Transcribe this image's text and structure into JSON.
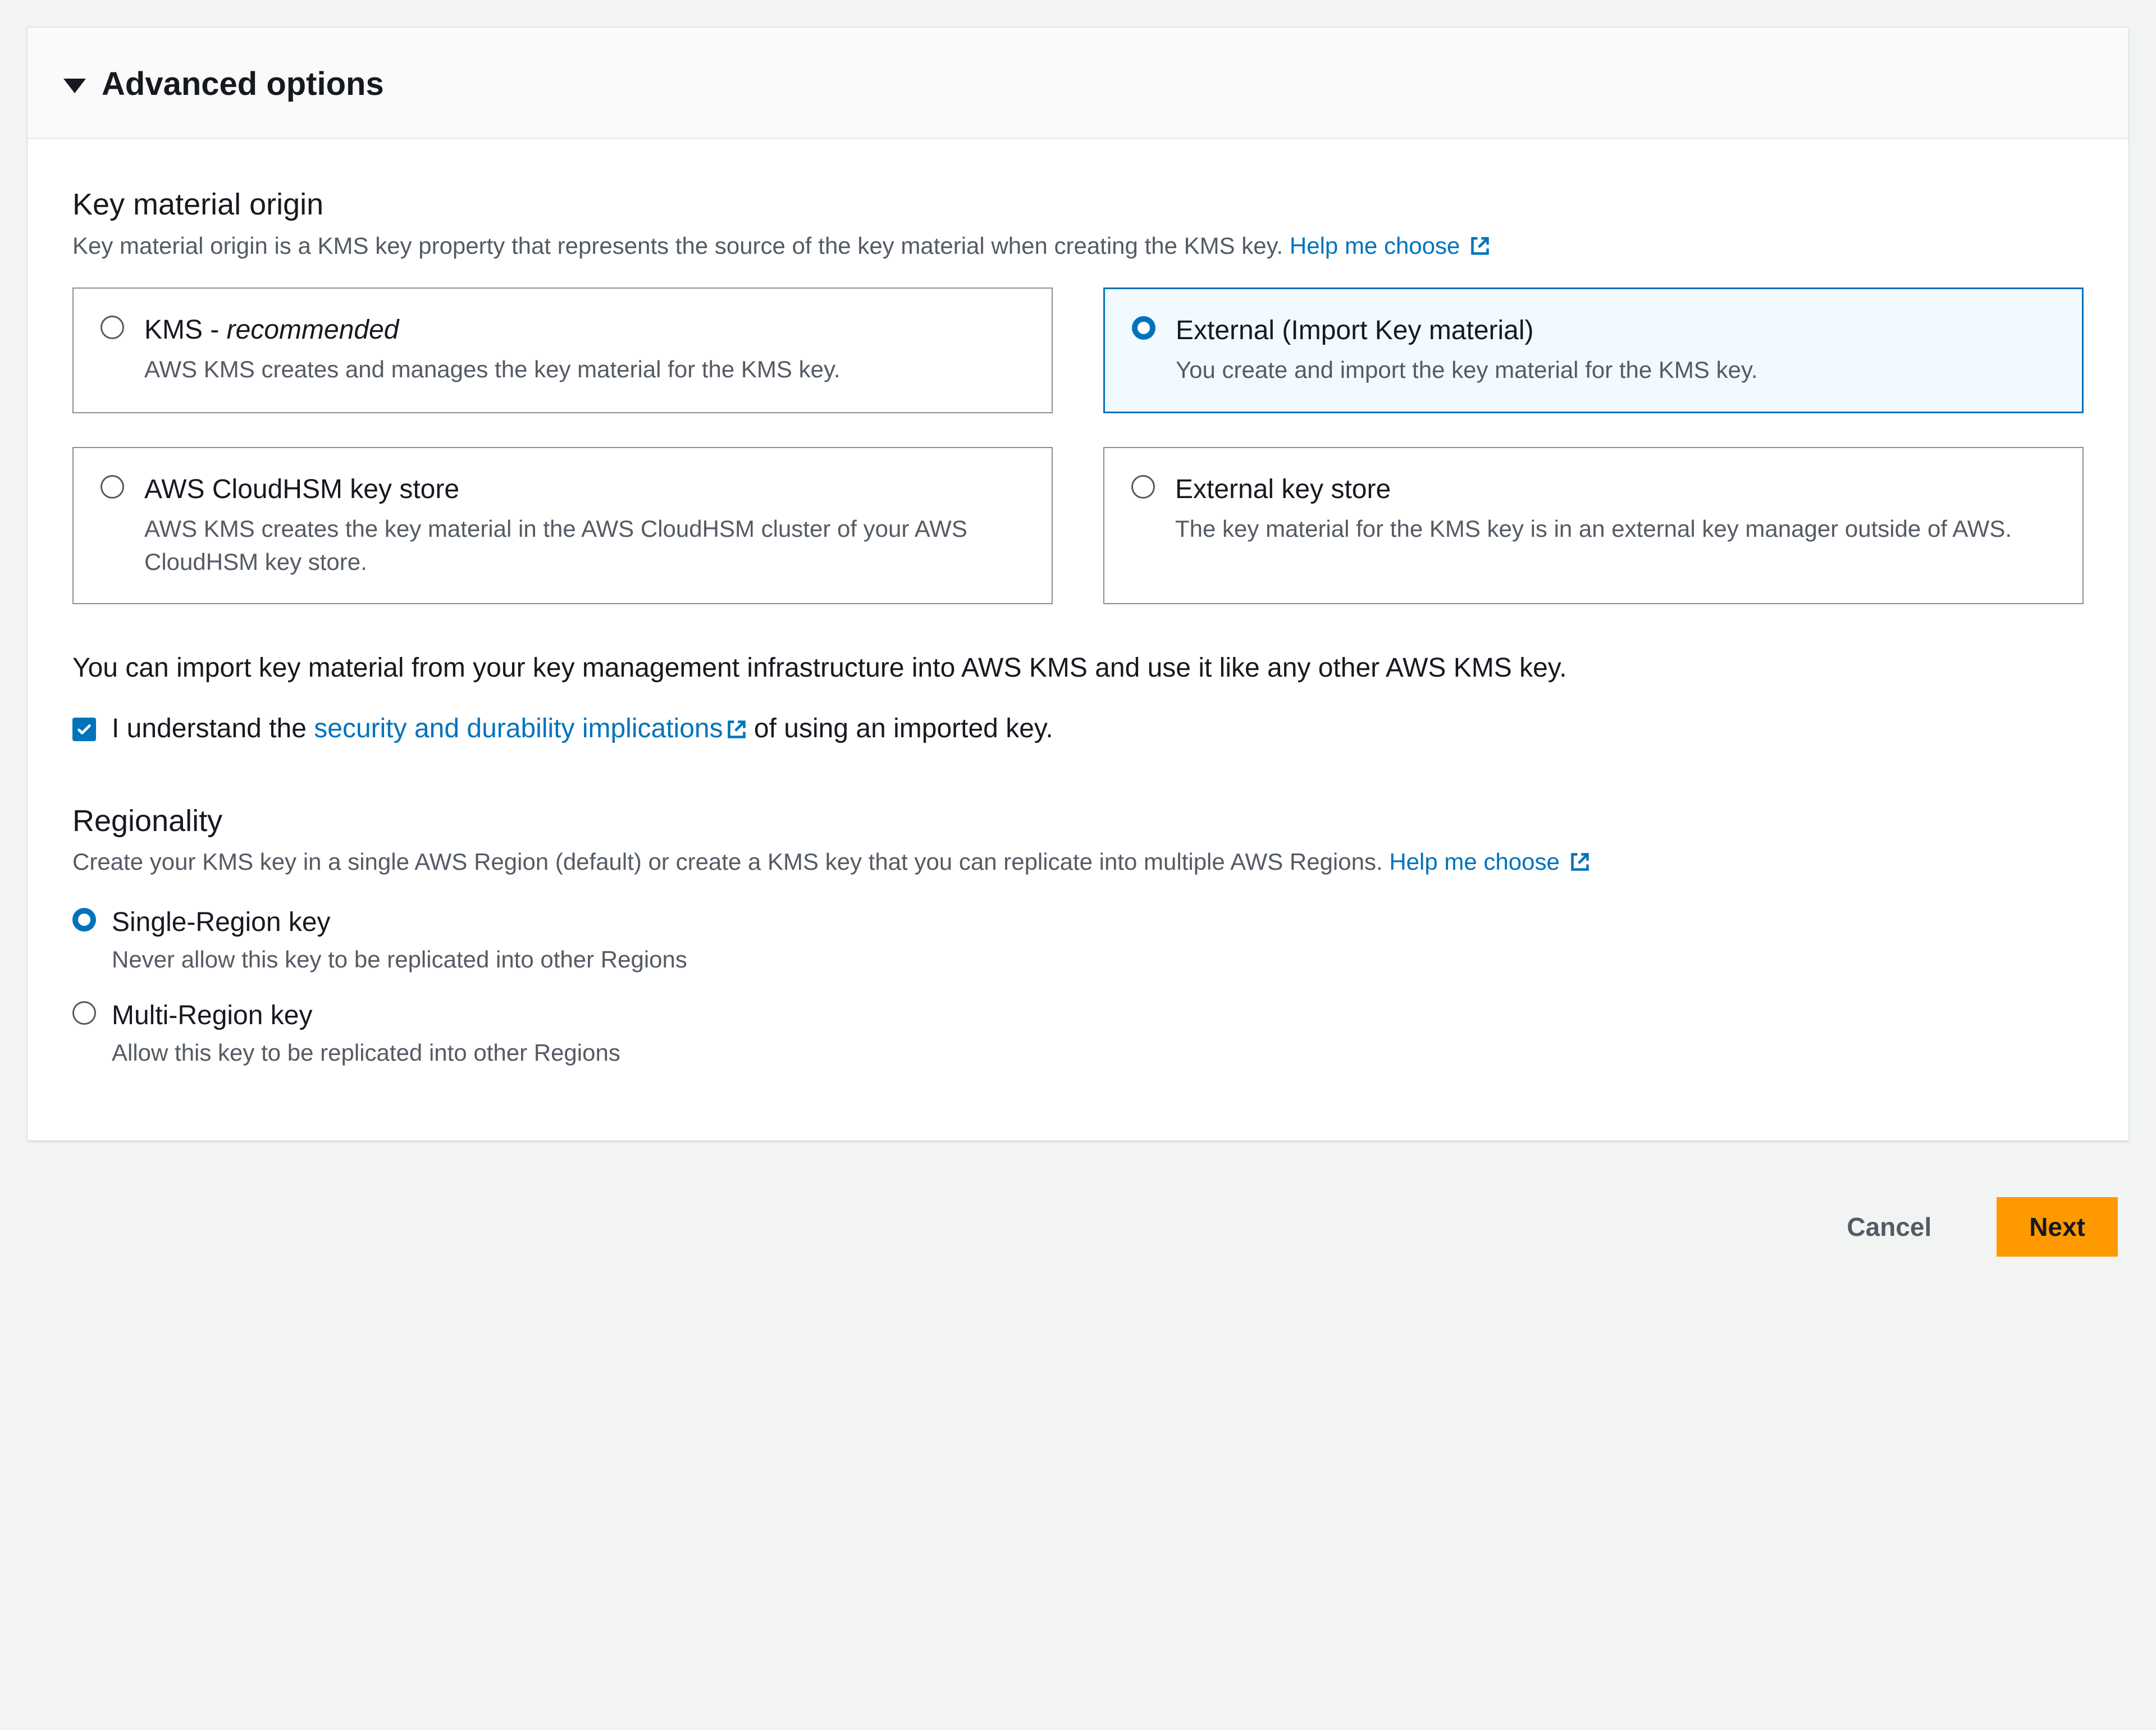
{
  "panel": {
    "title": "Advanced options"
  },
  "keyMaterial": {
    "title": "Key material origin",
    "description": "Key material origin is a KMS key property that represents the source of the key material when creating the KMS key. ",
    "helpLink": "Help me choose",
    "options": [
      {
        "title_prefix": "KMS - ",
        "title_italic": "recommended",
        "description": "AWS KMS creates and manages the key material for the KMS key.",
        "selected": false
      },
      {
        "title": "External (Import Key material)",
        "description": "You create and import the key material for the KMS key.",
        "selected": true
      },
      {
        "title": "AWS CloudHSM key store",
        "description": "AWS KMS creates the key material in the AWS CloudHSM cluster of your AWS CloudHSM key store.",
        "selected": false
      },
      {
        "title": "External key store",
        "description": "The key material for the KMS key is in an external key manager outside of AWS.",
        "selected": false
      }
    ]
  },
  "importNotice": {
    "text": "You can import key material from your key management infrastructure into AWS KMS and use it like any other AWS KMS key.",
    "checkbox_pre": "I understand the ",
    "checkbox_link": "security and durability implications",
    "checkbox_post": " of using an imported key."
  },
  "regionality": {
    "title": "Regionality",
    "description": "Create your KMS key in a single AWS Region (default) or create a KMS key that you can replicate into multiple AWS Regions. ",
    "helpLink": "Help me choose",
    "options": [
      {
        "label": "Single-Region key",
        "description": "Never allow this key to be replicated into other Regions",
        "selected": true
      },
      {
        "label": "Multi-Region key",
        "description": "Allow this key to be replicated into other Regions",
        "selected": false
      }
    ]
  },
  "footer": {
    "cancel": "Cancel",
    "next": "Next"
  }
}
